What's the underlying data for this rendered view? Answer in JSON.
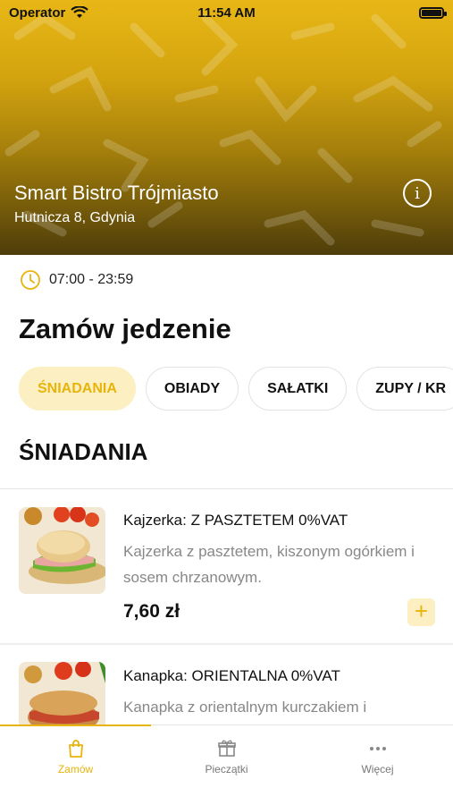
{
  "status_bar": {
    "carrier": "Operator",
    "time": "11:54 AM"
  },
  "venue": {
    "name": "Smart Bistro Trójmiasto",
    "address": "Hutnicza 8, Gdynia"
  },
  "hours": "07:00 - 23:59",
  "page_title": "Zamów jedzenie",
  "category_tabs": [
    "ŚNIADANIA",
    "OBIADY",
    "SAŁATKI",
    "ZUPY / KR"
  ],
  "active_category": "ŚNIADANIA",
  "category_heading": "ŚNIADANIA",
  "products": [
    {
      "name": "Kajzerka: Z PASZTETEM 0%VAT",
      "description": "Kajzerka z pasztetem, kiszonym ogórkiem i sosem chrzanowym.",
      "price": "7,60 zł",
      "add_label": "+"
    },
    {
      "name": "Kanapka: ORIENTALNA 0%VAT",
      "description": "Kanapka z orientalnym kurczakiem i"
    }
  ],
  "tab_bar": {
    "items": [
      "Zamów",
      "Pieczątki",
      "Więcej"
    ]
  },
  "colors": {
    "accent": "#e8b40c",
    "accent_light": "#fcefc2"
  }
}
